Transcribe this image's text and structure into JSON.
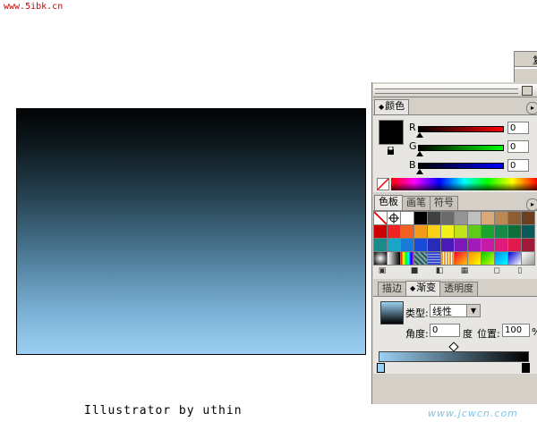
{
  "watermark_top": "www.5ibk.cn",
  "credit": "Illustrator by uthin",
  "watermark_bottom": "www.jcwcn.com",
  "colors": {
    "gradient_start": "#9bd0f2",
    "gradient_end": "#000000",
    "panel_bg": "#d4d0c8"
  },
  "topbox_label": "复",
  "color_panel": {
    "tab": "颜色",
    "sliders": [
      {
        "label": "R",
        "value": "0",
        "color": "#cc0000"
      },
      {
        "label": "G",
        "value": "0",
        "color": "#00bb00"
      },
      {
        "label": "B",
        "value": "0",
        "color": "#0000cc"
      }
    ]
  },
  "swatch_panel": {
    "tabs": [
      "色板",
      "画笔",
      "符号"
    ]
  },
  "gradient_panel": {
    "tabs": [
      "描边",
      "渐变",
      "透明度"
    ],
    "type_label": "类型:",
    "type_value": "线性",
    "angle_label": "角度:",
    "angle_value": "0",
    "angle_unit": "度",
    "position_label": "位置:",
    "position_value": "100",
    "position_unit": "%"
  }
}
